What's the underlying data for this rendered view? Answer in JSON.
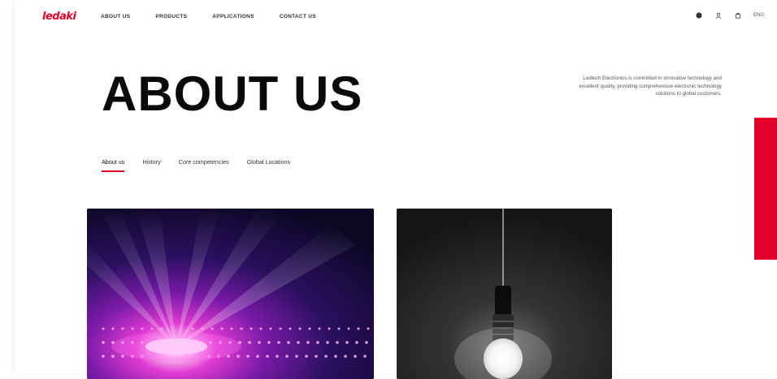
{
  "brand": {
    "logo_text": "ledaki",
    "accent_color": "#e4002b"
  },
  "nav": {
    "items": [
      {
        "label": "ABOUT US"
      },
      {
        "label": "PRODUCTS"
      },
      {
        "label": "APPLICATIONS"
      },
      {
        "label": "CONTACT US"
      }
    ]
  },
  "header_icons": [
    "globe-icon",
    "user-icon",
    "cart-icon"
  ],
  "language": "ENG",
  "hero": {
    "title": "ABOUT US",
    "intro": "Ledtech Electronics is committed to innovative technology and excellent quality, providing comprehensive electronic technology solutions to global customers."
  },
  "tabs": [
    {
      "label": "About us",
      "active": true
    },
    {
      "label": "History",
      "active": false
    },
    {
      "label": "Core competencies",
      "active": false
    },
    {
      "label": "Global Locations",
      "active": false
    }
  ]
}
